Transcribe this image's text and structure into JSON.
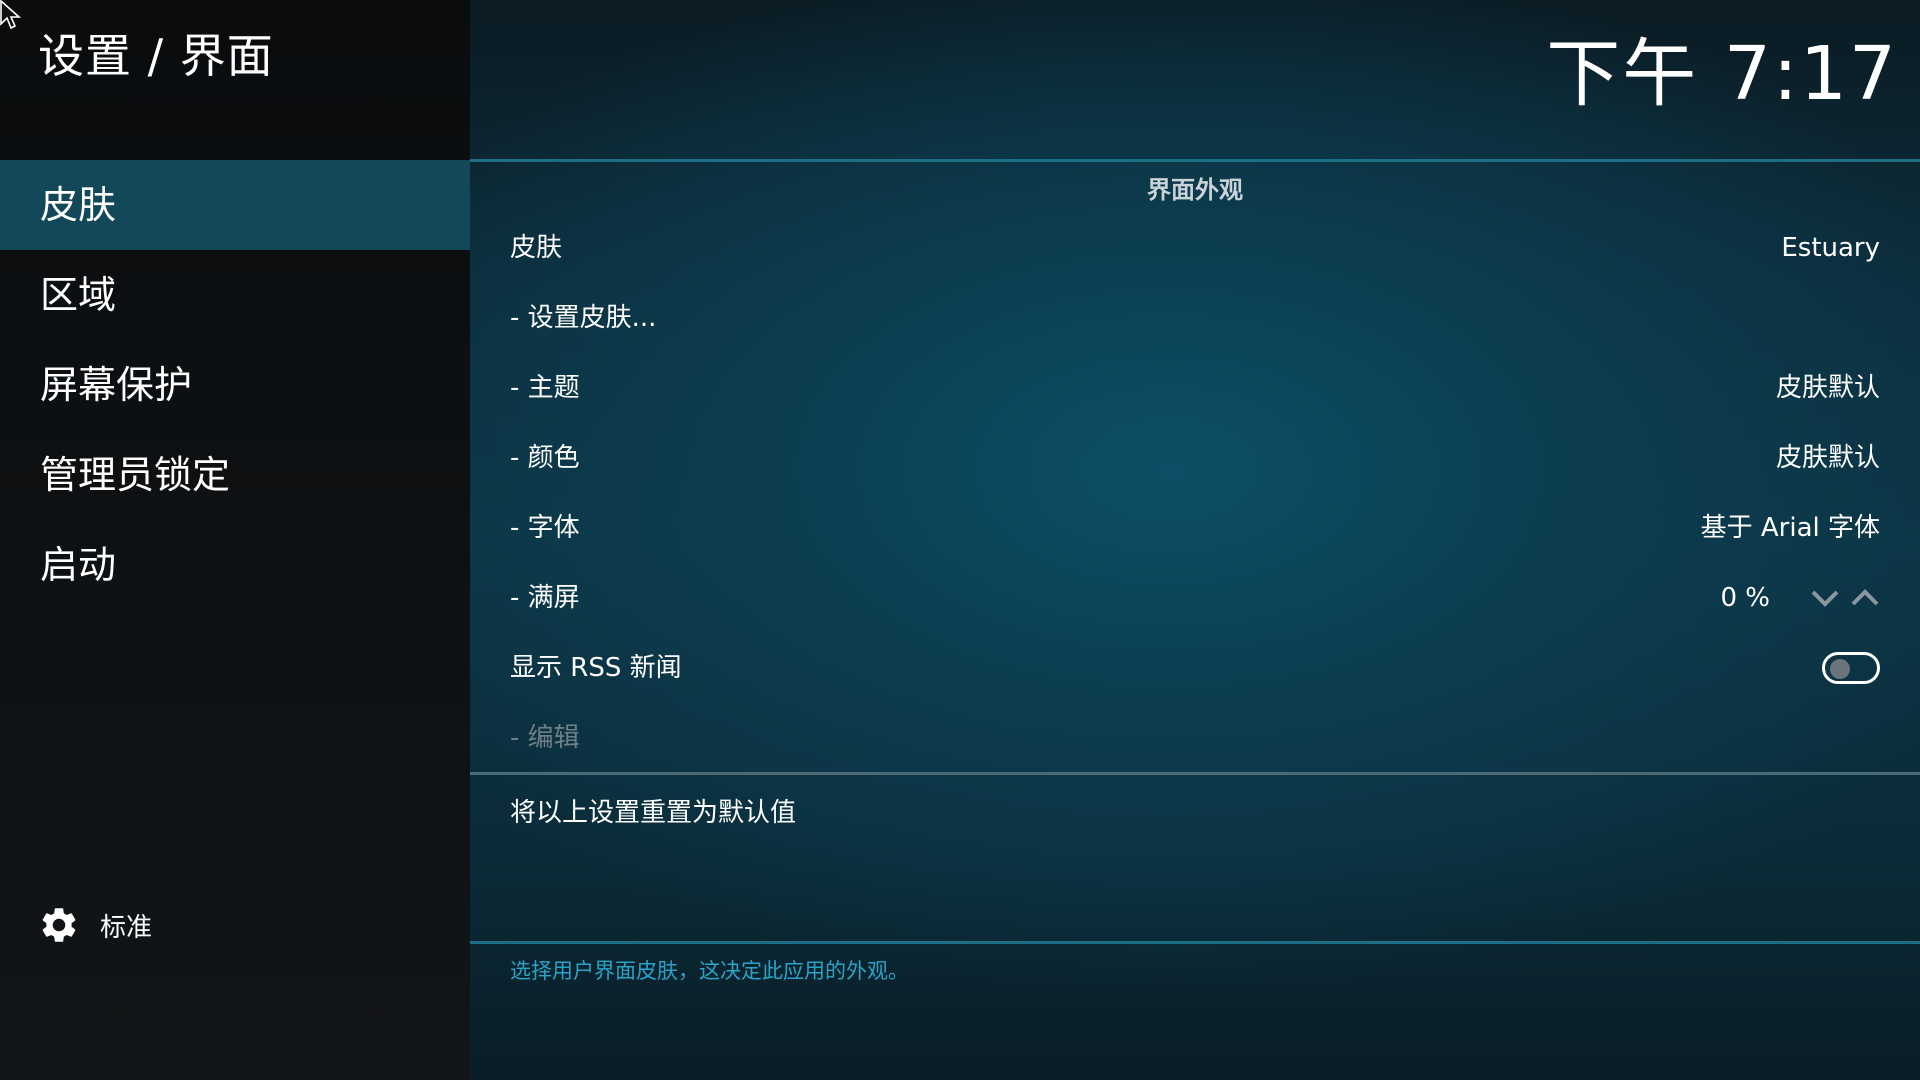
{
  "breadcrumb": "设置 / 界面",
  "clock": "下午 7:17",
  "nav": {
    "items": [
      {
        "label": "皮肤",
        "active": true
      },
      {
        "label": "区域",
        "active": false
      },
      {
        "label": "屏幕保护",
        "active": false
      },
      {
        "label": "管理员锁定",
        "active": false
      },
      {
        "label": "启动",
        "active": false
      }
    ]
  },
  "settings_level": {
    "icon": "gear-icon",
    "label": "标准"
  },
  "section": {
    "title": "界面外观"
  },
  "settings": {
    "skin": {
      "label": "皮肤",
      "value": "Estuary"
    },
    "configure_skin": {
      "label": "- 设置皮肤..."
    },
    "theme": {
      "label": "- 主题",
      "value": "皮肤默认"
    },
    "colors": {
      "label": "- 颜色",
      "value": "皮肤默认"
    },
    "fonts": {
      "label": "- 字体",
      "value": "基于 Arial 字体"
    },
    "zoom": {
      "label": "- 满屏",
      "value": "0 %"
    },
    "rss": {
      "label": "显示 RSS 新闻",
      "enabled": false
    },
    "edit": {
      "label": "- 编辑",
      "disabled": true
    }
  },
  "reset": {
    "label": "将以上设置重置为默认值"
  },
  "description": "选择用户界面皮肤，这决定此应用的外观。",
  "colors": {
    "active_nav": "#12485a",
    "accent_line": "#1d6f86",
    "description_text": "#2aa3c8"
  }
}
